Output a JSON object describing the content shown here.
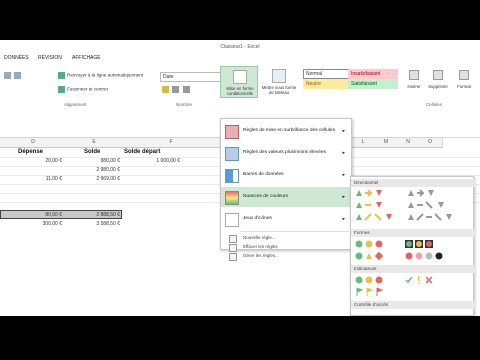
{
  "window": {
    "title": "Classeur1 - Excel"
  },
  "tabs": [
    "DONNÉES",
    "RÉVISION",
    "AFFICHAGE"
  ],
  "ribbon": {
    "wrap_text": "Renvoyer à la ligne automatiquement",
    "merge_center": "Fusionner et centrer",
    "alignment_group": "Alignement",
    "number_format": "Date",
    "number_group": "Nombre",
    "cond_format": "Mise en forme conditionnelle",
    "format_table": "Mettre sous forme de tableau",
    "style_normal": "Normal",
    "style_bad": "Insatisfaisant",
    "style_neutral": "Neutre",
    "style_good": "Satisfaisant",
    "insert": "Insérer",
    "delete": "Supprimer",
    "format": "Format",
    "cells_group": "Cellules"
  },
  "columns": [
    "D",
    "E",
    "F",
    "L",
    "M",
    "N",
    "O"
  ],
  "sheet": {
    "headers": {
      "d": "Dépense",
      "e": "Solde",
      "f": "Solde départ"
    },
    "rows": [
      {
        "d": "20,00 €",
        "e": "980,00 €",
        "f": "1 000,00 €"
      },
      {
        "d": "",
        "e": "2 980,00 €",
        "f": ""
      },
      {
        "d": "11,00 €",
        "e": "2 969,00 €",
        "f": ""
      },
      {
        "d": "80,50 €",
        "e": "2 888,50 €",
        "f": ""
      },
      {
        "d": "300,00 €",
        "e": "3 588,50 €",
        "f": ""
      }
    ]
  },
  "menu": {
    "items": [
      "Règles de mise en surbrillance des cellules",
      "Règles des valeurs plus/moins élevées",
      "Barres de données",
      "Nuances de couleurs",
      "Jeux d'icônes"
    ],
    "small_items": [
      "Nouvelle règle...",
      "Effacer les règles",
      "Gérer les règles..."
    ]
  },
  "submenu": {
    "sections": [
      "Directionnel",
      "Formes",
      "Indicateurs",
      "Contrôle d'accès"
    ]
  },
  "colors": {
    "accent": "#217346",
    "selected": "#cfe8d3",
    "bad": "#ffc7ce",
    "neutral": "#ffeb9c",
    "good": "#c6efce"
  }
}
